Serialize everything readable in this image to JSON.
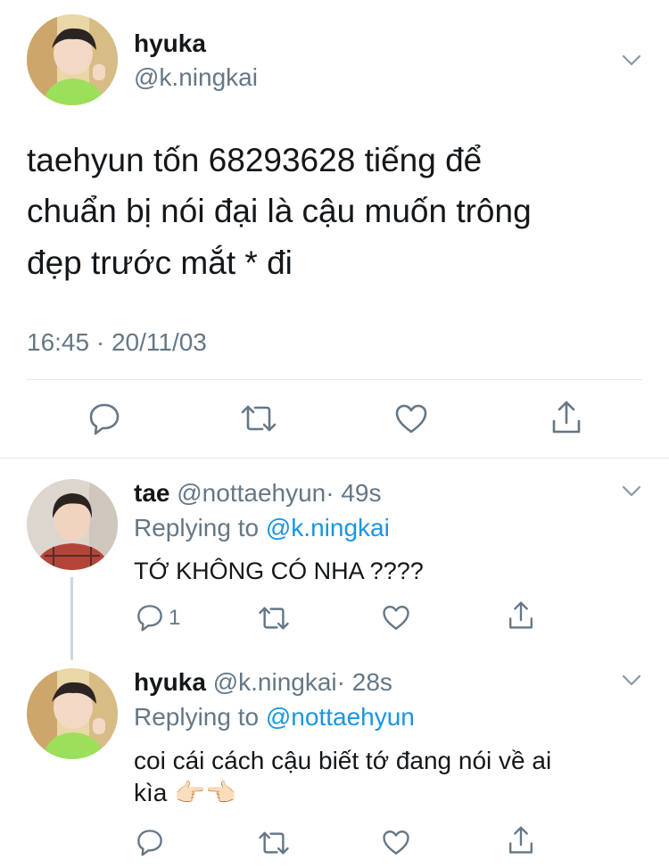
{
  "main_tweet": {
    "display_name": "hyuka",
    "handle": "@k.ningkai",
    "text_line1": "taehyun tốn 68293628 tiếng để",
    "text_line2": "chuẩn bị nói đại là cậu muốn trông",
    "text_line3": "đẹp trước mắt * đi",
    "timestamp": "16:45 · 20/11/03"
  },
  "replies": [
    {
      "display_name": "tae",
      "handle": "@nottaehyun",
      "age": "· 49s",
      "replying_prefix": "Replying to",
      "replying_to": "@k.ningkai",
      "text_line1": "TỚ KHÔNG CÓ NHA ????",
      "text_line2": "",
      "reply_count": "1"
    },
    {
      "display_name": "hyuka",
      "handle": "@k.ningkai",
      "age": "· 28s",
      "replying_prefix": "Replying to",
      "replying_to": "@nottaehyun",
      "text_line1": "coi cái cách cậu biết tớ đang nói về ai",
      "text_line2": "kìa 👉🏻👈🏻",
      "reply_count": ""
    }
  ],
  "colors": {
    "text": "#14171a",
    "muted": "#657786",
    "link": "#1b95e0",
    "divider": "#e1e8ed"
  },
  "icons": [
    "chevron-down-icon",
    "reply-icon",
    "retweet-icon",
    "like-icon",
    "share-icon"
  ]
}
